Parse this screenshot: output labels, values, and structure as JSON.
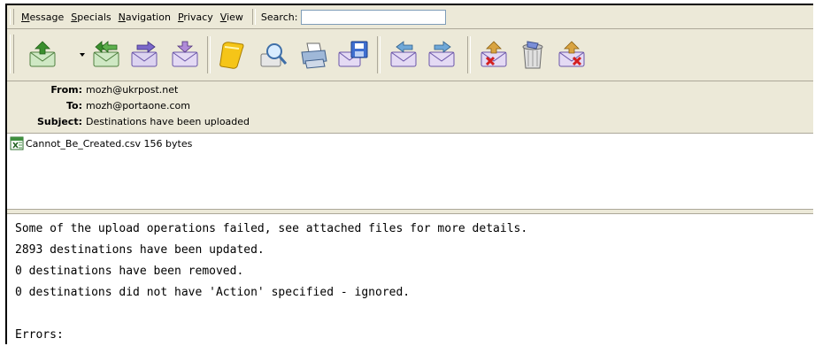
{
  "menubar": {
    "items": [
      {
        "pre": "",
        "u": "M",
        "post": "essage"
      },
      {
        "pre": "",
        "u": "S",
        "post": "pecials"
      },
      {
        "pre": "",
        "u": "N",
        "post": "avigation"
      },
      {
        "pre": "",
        "u": "P",
        "post": "rivacy"
      },
      {
        "pre": "",
        "u": "V",
        "post": "iew"
      }
    ],
    "search_label": "Search:",
    "search_value": ""
  },
  "toolbar": {
    "buttons": [
      {
        "name": "get-mail-icon"
      },
      {
        "name": "reply-all-icon"
      },
      {
        "name": "forward-icon"
      },
      {
        "name": "compose-icon"
      },
      {
        "name": "address-book-icon"
      },
      {
        "name": "find-icon"
      },
      {
        "name": "print-icon"
      },
      {
        "name": "save-icon"
      },
      {
        "name": "previous-message-icon"
      },
      {
        "name": "next-message-icon"
      },
      {
        "name": "junk-icon"
      },
      {
        "name": "delete-icon"
      },
      {
        "name": "stop-icon"
      }
    ]
  },
  "headers": {
    "from_label": "From:",
    "from_value": "mozh@ukrpost.net",
    "to_label": "To:",
    "to_value": "mozh@portaone.com",
    "subject_label": "Subject:",
    "subject_value": "Destinations have been uploaded"
  },
  "attachments": [
    {
      "name": "Cannot_Be_Created.csv 156 bytes"
    }
  ],
  "body": {
    "lines": [
      "Some of the upload operations failed, see attached files for more details.",
      "2893 destinations have been updated.",
      "0 destinations have been removed.",
      "0 destinations did not have 'Action' specified - ignored.",
      "",
      "Errors:"
    ]
  },
  "colors": {
    "chrome": "#ece9d8",
    "envelope": "#7fb26a",
    "arrow": "#3b8f2e",
    "note": "#f5c518"
  }
}
